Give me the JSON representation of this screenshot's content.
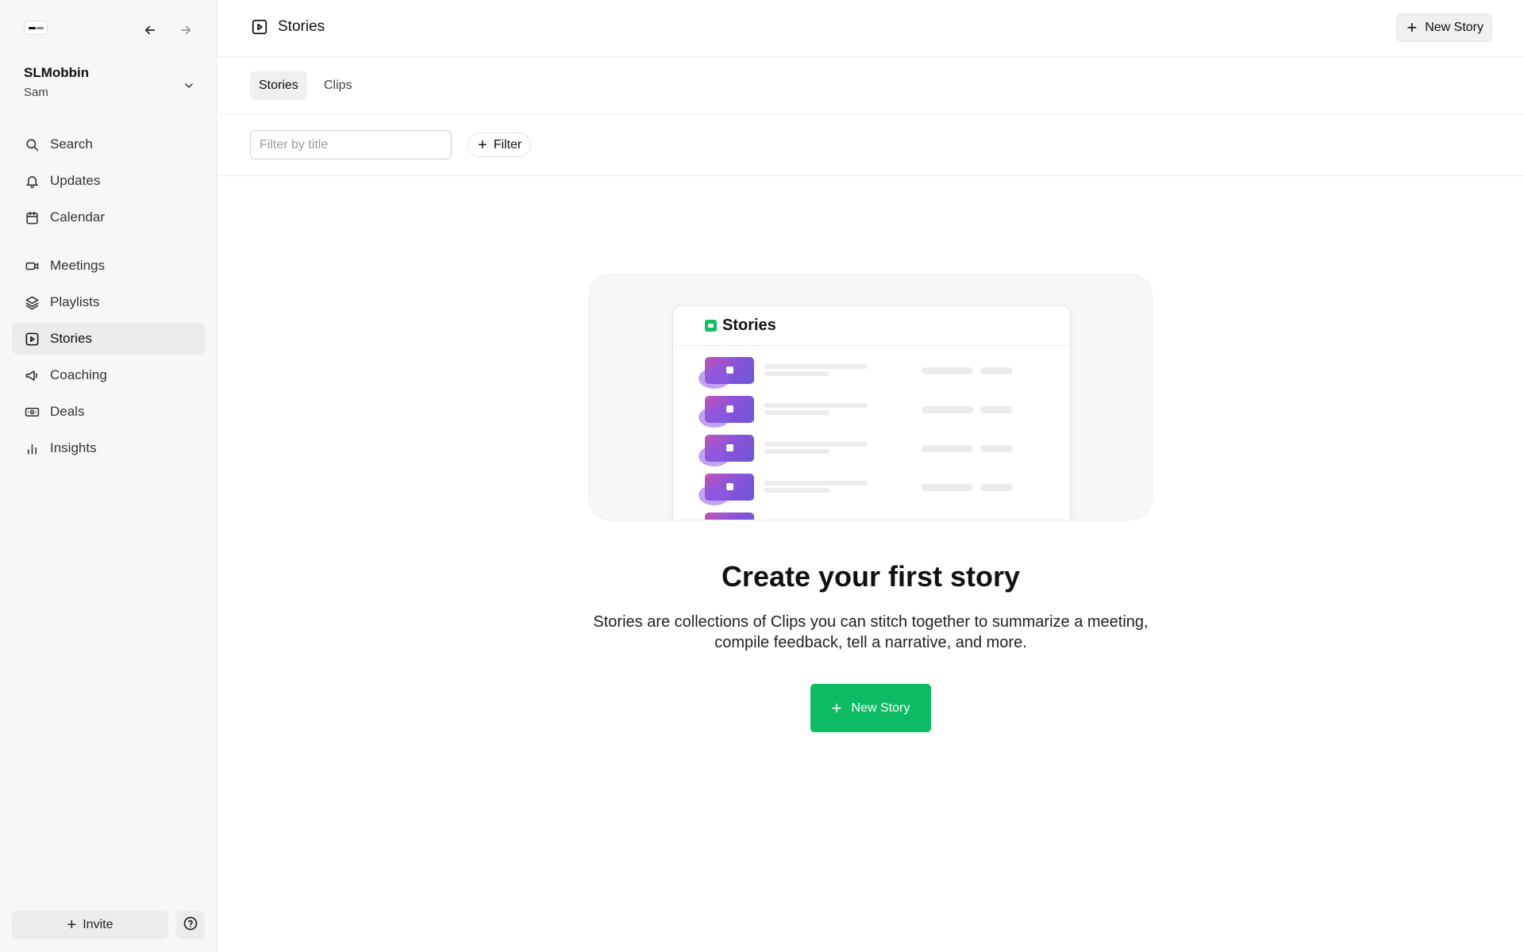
{
  "sidebar": {
    "workspace_name": "SLMobbin",
    "user_name": "Sam",
    "items_top": [
      {
        "label": "Search",
        "icon": "search-icon"
      },
      {
        "label": "Updates",
        "icon": "bell-icon"
      },
      {
        "label": "Calendar",
        "icon": "calendar-icon"
      }
    ],
    "items_main": [
      {
        "label": "Meetings",
        "icon": "video-icon"
      },
      {
        "label": "Playlists",
        "icon": "layers-icon"
      },
      {
        "label": "Stories",
        "icon": "play-square-icon",
        "active": true
      },
      {
        "label": "Coaching",
        "icon": "megaphone-icon"
      },
      {
        "label": "Deals",
        "icon": "money-icon"
      },
      {
        "label": "Insights",
        "icon": "bar-chart-icon"
      }
    ],
    "invite_label": "Invite"
  },
  "header": {
    "title": "Stories",
    "new_story_label": "New Story"
  },
  "tabs": [
    {
      "label": "Stories",
      "active": true
    },
    {
      "label": "Clips",
      "active": false
    }
  ],
  "filters": {
    "search_placeholder": "Filter by title",
    "filter_label": "Filter"
  },
  "empty_state": {
    "illustration_title": "Stories",
    "title": "Create your first story",
    "description": "Stories are collections of Clips you can stitch together to summarize a meeting, compile feedback, tell a narrative, and more.",
    "button_label": "New Story"
  },
  "colors": {
    "accent_green": "#0cbb63",
    "sidebar_bg": "#f7f7f7",
    "active_item_bg": "#ebebeb"
  }
}
